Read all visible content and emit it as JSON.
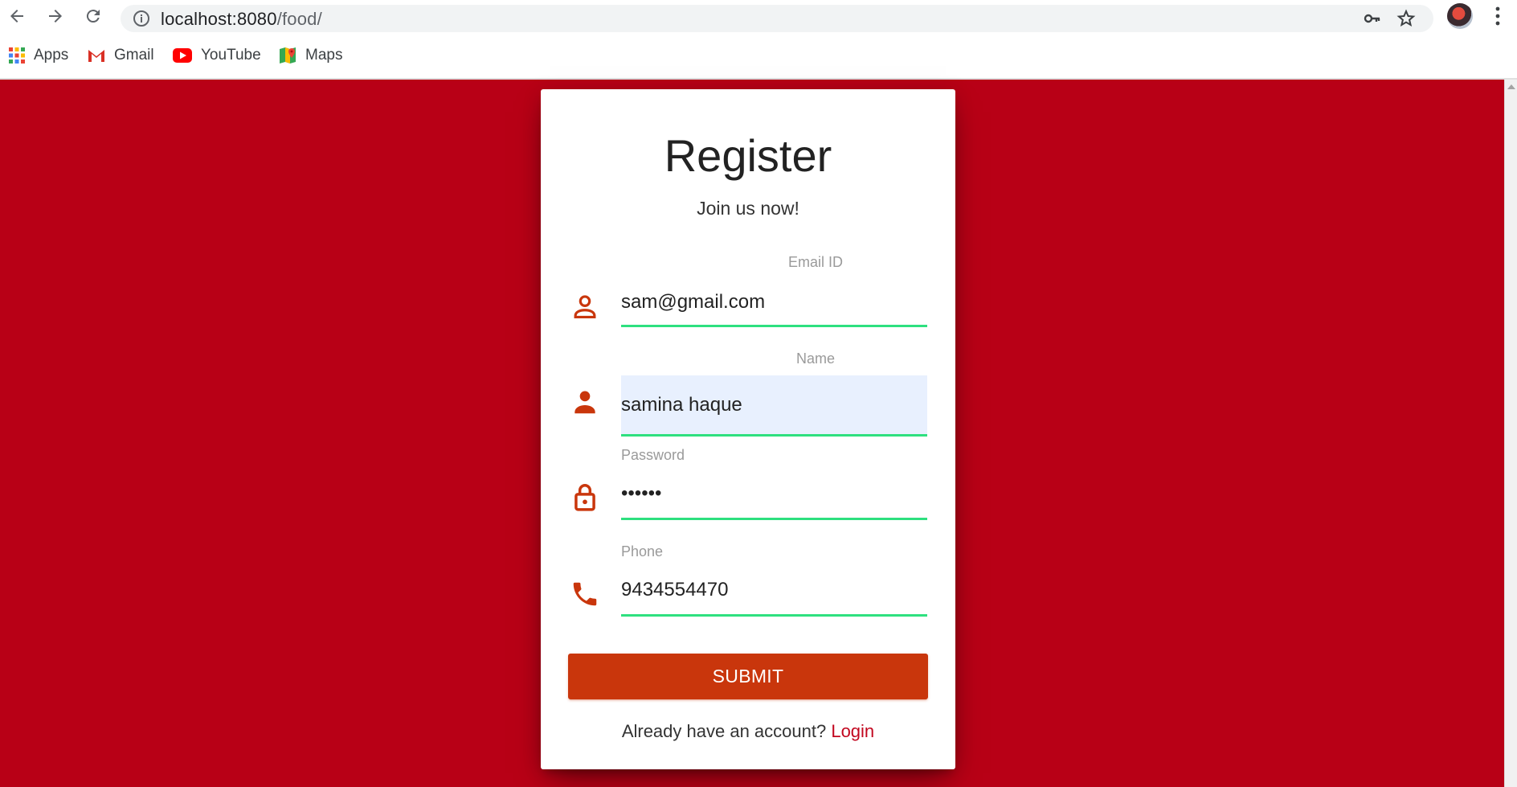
{
  "browser": {
    "url_host": "localhost:8080",
    "url_path": "/food/",
    "bookmarks": [
      {
        "label": "Apps",
        "icon": "apps-grid-icon"
      },
      {
        "label": "Gmail",
        "icon": "gmail-icon"
      },
      {
        "label": "YouTube",
        "icon": "youtube-icon"
      },
      {
        "label": "Maps",
        "icon": "maps-icon"
      }
    ]
  },
  "form": {
    "title": "Register",
    "subtitle": "Join us now!",
    "fields": [
      {
        "label": "Email ID",
        "value": "sam@gmail.com",
        "icon": "person-outline-icon"
      },
      {
        "label": "Name",
        "value": "samina haque",
        "icon": "person-icon"
      },
      {
        "label": "Password",
        "value": "••••••",
        "icon": "lock-icon"
      },
      {
        "label": "Phone",
        "value": "9434554470",
        "icon": "phone-icon"
      }
    ],
    "submit_label": "SUBMIT",
    "footer_text": "Already have an account? ",
    "login_link": "Login"
  },
  "colors": {
    "background": "#b80016",
    "accent": "#c9360c",
    "underline": "#2ee07f",
    "link": "#c2071f"
  }
}
